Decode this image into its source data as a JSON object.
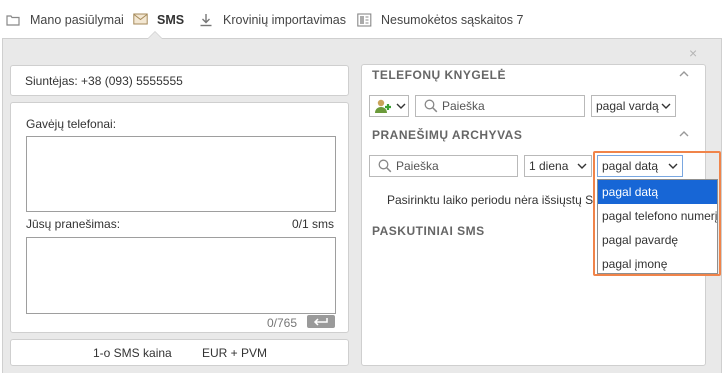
{
  "nav": {
    "items": [
      {
        "label": "Mano pasiūlymai",
        "icon": "folder-icon"
      },
      {
        "label": "SMS",
        "icon": "envelope-icon",
        "active": true
      },
      {
        "label": "Krovinių importavimas",
        "icon": "download-icon"
      },
      {
        "label": "Nesumokėtos sąskaitos 7",
        "icon": "invoice-icon"
      }
    ]
  },
  "close_symbol": "×",
  "sender": {
    "text": "Siuntėjas: +38 (093) 5555555"
  },
  "compose": {
    "recipients_label": "Gavėjų telefonai:",
    "message_label": "Jūsų pranešimas:",
    "sms_count": "0/1 sms",
    "char_count": "0/765"
  },
  "price": {
    "label": "1-o SMS kaina",
    "value": "EUR + PVM"
  },
  "phonebook": {
    "title": "TELEFONŲ KNYGELĖ",
    "search_placeholder": "Paieška",
    "sort_selected": "pagal vardą"
  },
  "archive": {
    "title": "PRANEŠIMŲ ARCHYVAS",
    "search_placeholder": "Paieška",
    "period_selected": "1 diena",
    "sort_selected": "pagal datą",
    "empty_message": "Pasirinktu laiko periodu nėra išsiųstų S",
    "sort_options": [
      "pagal datą",
      "pagal telefono numerį",
      "pagal pavardę",
      "pagal įmonę"
    ],
    "sort_selected_index": 0
  },
  "recent": {
    "title": "PASKUTINIAI SMS"
  },
  "colors": {
    "accent_highlight": "#f0844a",
    "selected_option": "#1766d6",
    "panel_bg": "#e9e9e9"
  }
}
